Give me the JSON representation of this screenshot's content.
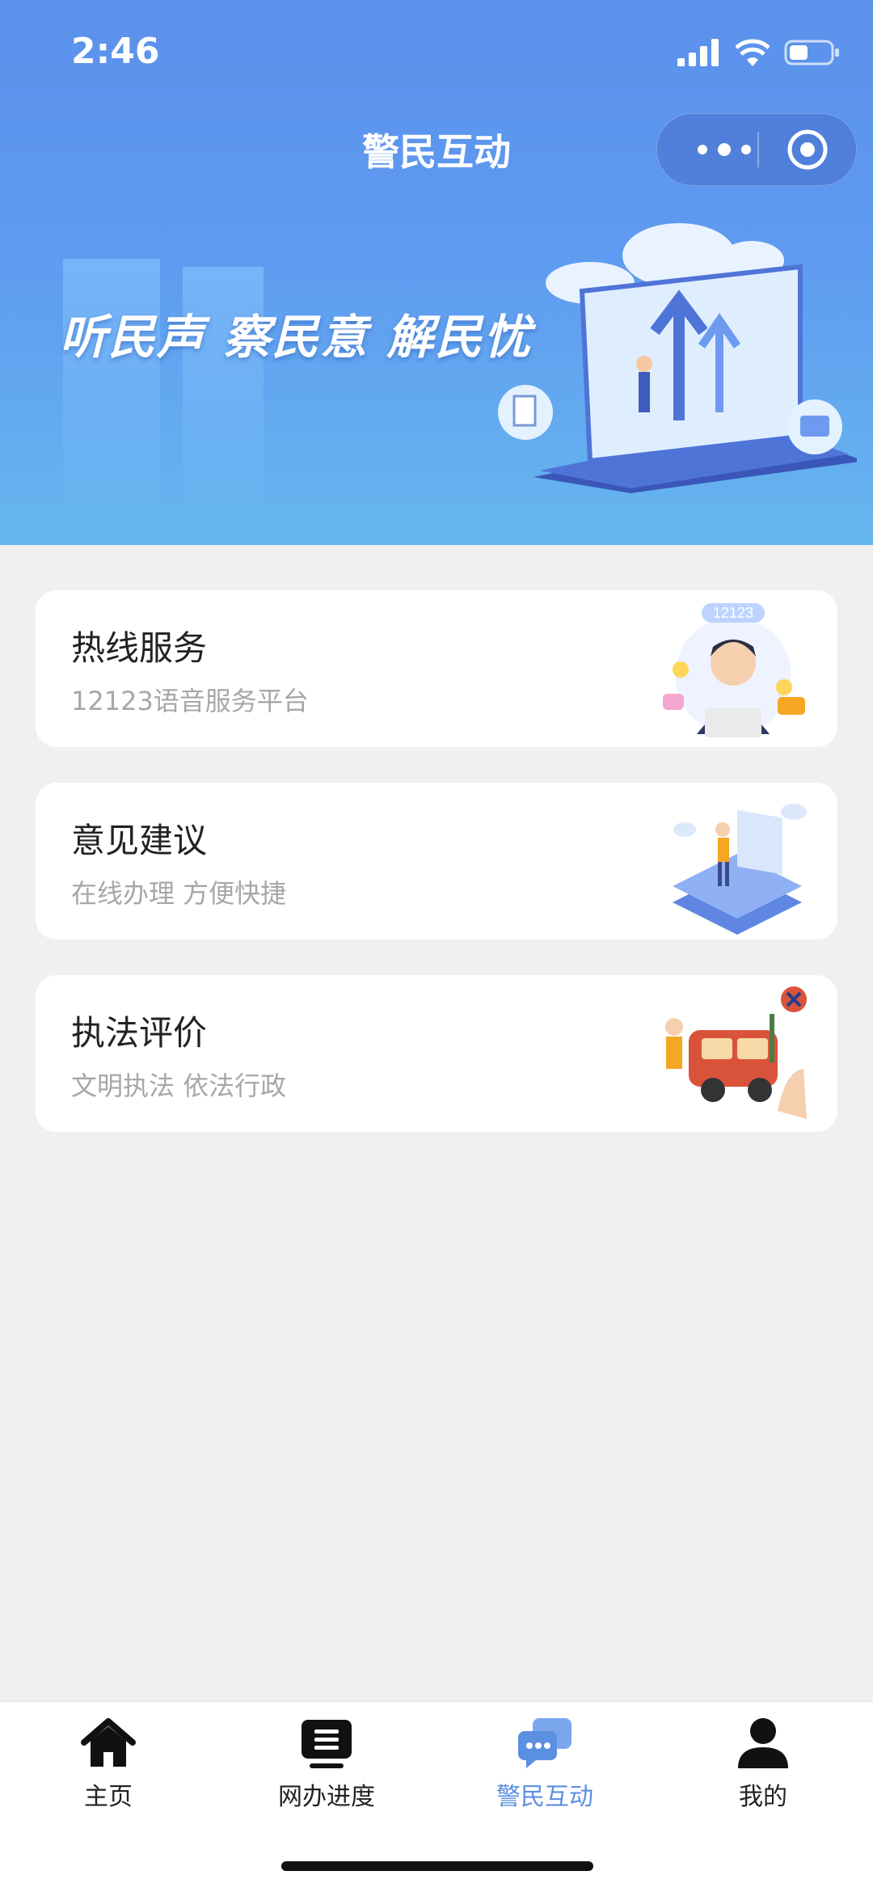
{
  "status": {
    "time": "2:46"
  },
  "header": {
    "title": "警民互动",
    "slogan": "听民声  察民意  解民忧"
  },
  "cards": [
    {
      "title": "热线服务",
      "subtitle": "12123语音服务平台",
      "badge": "12123"
    },
    {
      "title": "意见建议",
      "subtitle": "在线办理 方便快捷"
    },
    {
      "title": "执法评价",
      "subtitle": "文明执法 依法行政"
    }
  ],
  "tabbar": {
    "items": [
      {
        "label": "主页",
        "icon": "home-icon"
      },
      {
        "label": "网办进度",
        "icon": "progress-icon"
      },
      {
        "label": "警民互动",
        "icon": "chat-icon",
        "active": true
      },
      {
        "label": "我的",
        "icon": "user-icon"
      }
    ]
  },
  "colors": {
    "accent": "#5b8fe0",
    "header_top": "#5b91eb",
    "header_bottom": "#66b6ef"
  }
}
